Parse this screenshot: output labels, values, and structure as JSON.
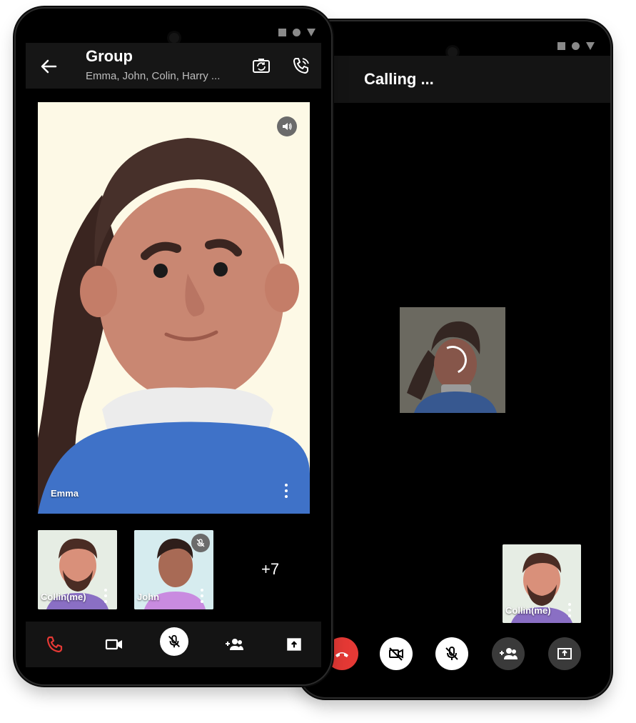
{
  "back_phone": {
    "title": "Calling ...",
    "self_tile": {
      "name": "Collin(me)"
    },
    "controls": [
      "end-call",
      "camera-off",
      "mic-off",
      "add-participant",
      "share-screen"
    ]
  },
  "front_phone": {
    "header": {
      "title": "Group",
      "members": "Emma, John, Colin, Harry ..."
    },
    "main_tile": {
      "name": "Emma"
    },
    "thumbnails": [
      {
        "name": "Collin(me)"
      },
      {
        "name": "John"
      }
    ],
    "more_count": "+7",
    "controls": [
      "end-call",
      "video",
      "mic-off",
      "add-participant",
      "share-screen"
    ]
  },
  "colors": {
    "end_call_red": "#e53935",
    "shirt_blue": "#3f72c8",
    "tile_cream": "#fdf9e6"
  }
}
